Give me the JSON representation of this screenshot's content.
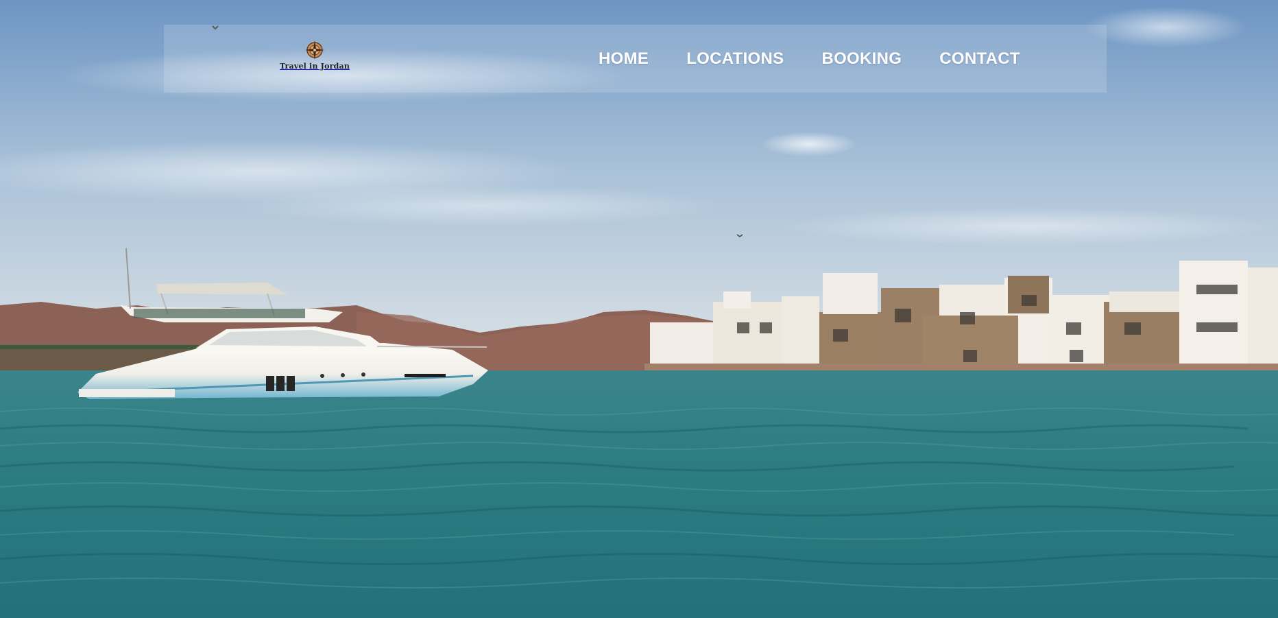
{
  "brand": {
    "name": "Travel in Jordan",
    "logo_icon": "compass-icon"
  },
  "nav": {
    "items": [
      {
        "label": "HOME"
      },
      {
        "label": "LOCATIONS"
      },
      {
        "label": "BOOKING"
      },
      {
        "label": "CONTACT"
      }
    ]
  },
  "hero": {
    "scene": "yacht-on-sea-with-resort-background",
    "colors": {
      "sky_top": "#6f97c4",
      "sky_bottom": "#d7dfe4",
      "sea_top": "#2f7f86",
      "sea_bottom": "#1f6a73",
      "mountains": "#8a5f55",
      "buildings_light": "#f0ece4",
      "buildings_stone": "#9a7d62",
      "yacht_hull": "#f4f4f0",
      "yacht_stripe": "#5fa9c8"
    }
  }
}
